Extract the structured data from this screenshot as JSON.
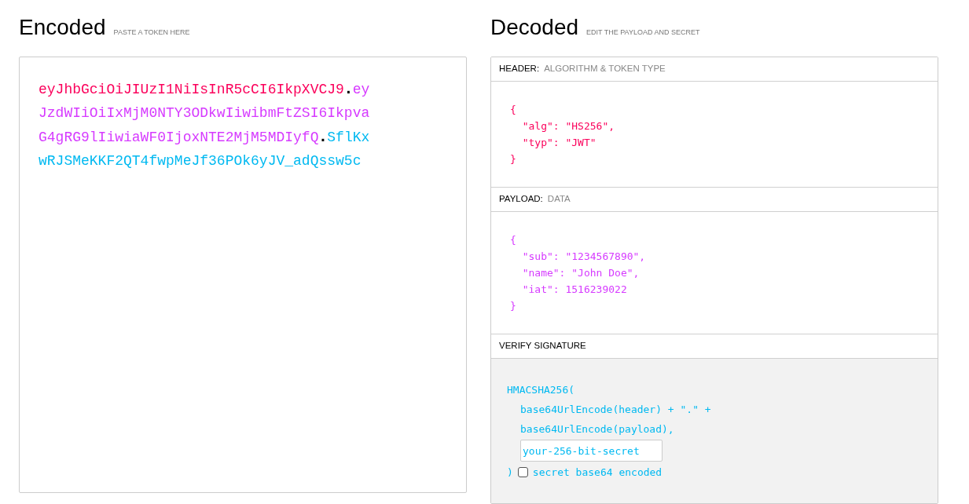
{
  "encoded": {
    "title": "Encoded",
    "subtitle": "PASTE A TOKEN HERE",
    "token": [
      {
        "text": "eyJhbGciOiJIUzI1NiIsInR5cCI6IkpXVCJ9",
        "color": "#fb015b"
      },
      {
        "text": ".",
        "color": "#000000"
      },
      {
        "text": "eyJzdWIiOiIxMjM0NTY3ODkwIiwibmFtZSI6IkpvaG4gRG9lIiwiaWF0IjoxNTE2MjM5MDIyfQ",
        "color": "#d63aff"
      },
      {
        "text": ".",
        "color": "#000000"
      },
      {
        "text": "SflKxwRJSMeKKF2QT4fwpMeJf36POk6yJV_adQssw5c",
        "color": "#00b9f1"
      }
    ]
  },
  "decoded": {
    "title": "Decoded",
    "subtitle": "EDIT THE PAYLOAD AND SECRET",
    "sections": [
      {
        "kind": "json",
        "label": "HEADER:",
        "sublabel": "ALGORITHM & TOKEN TYPE",
        "color": "#fb015b",
        "code": "{\n  \"alg\": \"HS256\",\n  \"typ\": \"JWT\"\n}"
      },
      {
        "kind": "json",
        "label": "PAYLOAD:",
        "sublabel": "DATA",
        "color": "#d63aff",
        "code": "{\n  \"sub\": \"1234567890\",\n  \"name\": \"John Doe\",\n  \"iat\": 1516239022\n}"
      },
      {
        "kind": "verify",
        "label": "VERIFY SIGNATURE",
        "color": "#00b9f1",
        "lines": [
          "HMACSHA256(",
          "base64UrlEncode(header) + \".\" +",
          "base64UrlEncode(payload),"
        ],
        "secret": "your-256-bit-secret",
        "close": ")",
        "checkbox": {
          "label": "secret base64 encoded",
          "checked": false
        }
      }
    ]
  }
}
